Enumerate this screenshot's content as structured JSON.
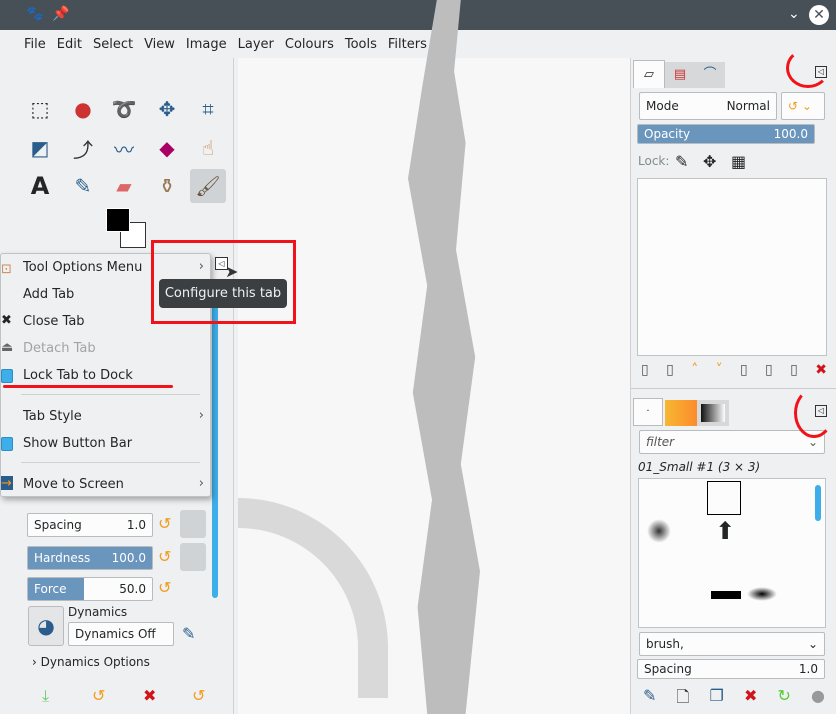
{
  "menubar": [
    "File",
    "Edit",
    "Select",
    "View",
    "Image",
    "Layer",
    "Colours",
    "Tools",
    "Filters"
  ],
  "context_menu": {
    "items": [
      {
        "label": "Tool Options Menu",
        "submenu": true
      },
      {
        "label": "Add Tab"
      },
      {
        "label": "Close Tab"
      },
      {
        "label": "Detach Tab",
        "disabled": true
      },
      {
        "label": "Lock Tab to Dock",
        "checked": true
      },
      {
        "label": "Tab Style",
        "submenu": true
      },
      {
        "label": "Show Button Bar",
        "checked": true
      },
      {
        "label": "Move to Screen",
        "submenu": true
      }
    ]
  },
  "tooltip": "Configure this tab",
  "tool_options": {
    "spacing_label": "Spacing",
    "spacing_value": "1.0",
    "hardness_label": "Hardness",
    "hardness_value": "100.0",
    "force_label": "Force",
    "force_value": "50.0",
    "dynamics_label": "Dynamics",
    "dynamics_value": "Dynamics Off",
    "dynamics_options": "Dynamics Options"
  },
  "layers": {
    "mode_label": "Mode",
    "mode_value": "Normal",
    "opacity_label": "Opacity",
    "opacity_value": "100.0",
    "lock_label": "Lock:"
  },
  "brushes": {
    "filter_placeholder": "filter",
    "current": "01_Small #1 (3 × 3)",
    "tag_value": "brush,",
    "spacing_label": "Spacing",
    "spacing_value": "1.0"
  },
  "colors": {
    "accent": "#3daee9",
    "annotation": "#f0141a",
    "slider": "#6a95bd"
  }
}
